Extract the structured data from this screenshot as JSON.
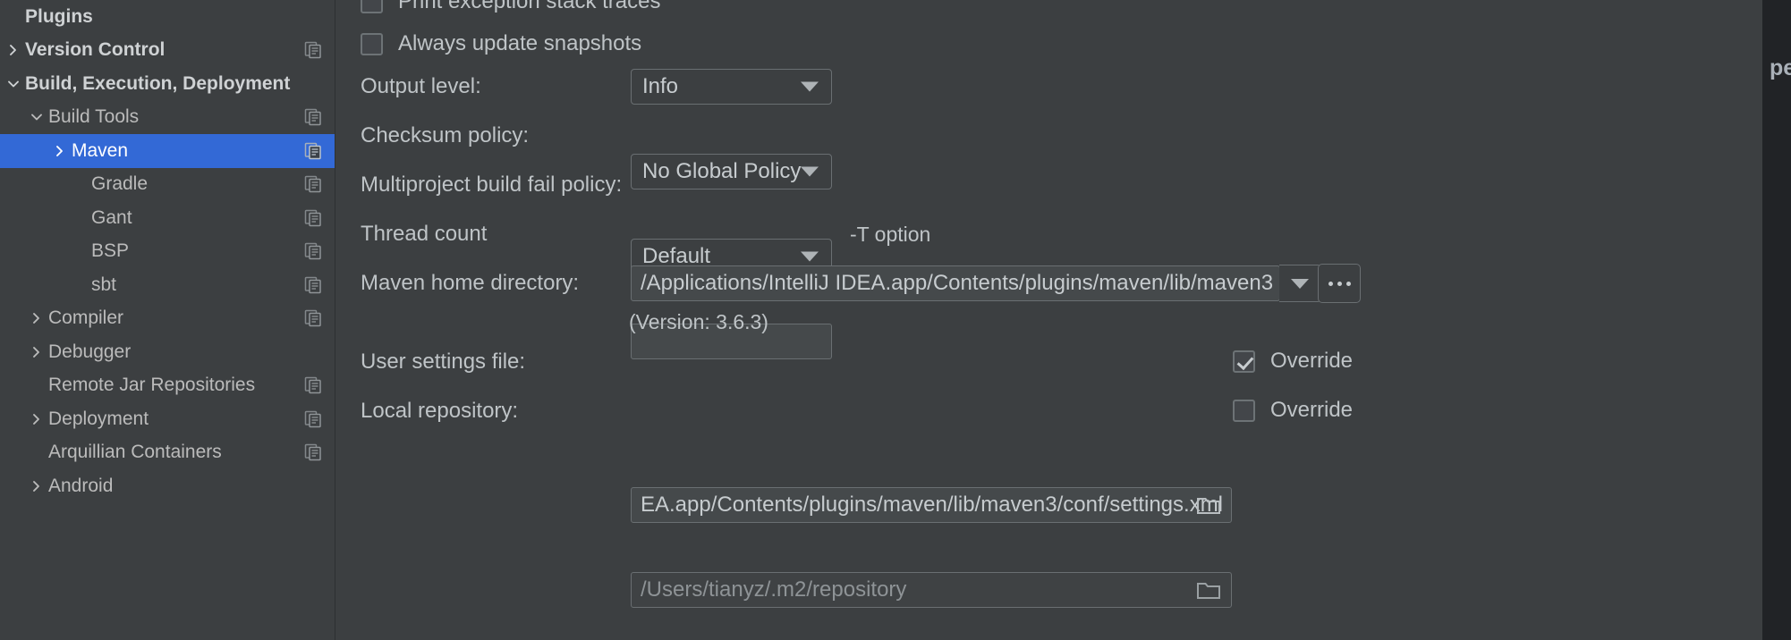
{
  "dialog": {
    "backdrop_text": "pe"
  },
  "sidebar": {
    "items": [
      {
        "label": "Plugins",
        "indent": 0,
        "twisty": "none",
        "bold": true,
        "selected": false,
        "copy": false
      },
      {
        "label": "Version Control",
        "indent": 0,
        "twisty": "collapsed",
        "bold": true,
        "selected": false,
        "copy": true
      },
      {
        "label": "Build, Execution, Deployment",
        "indent": 0,
        "twisty": "expanded",
        "bold": true,
        "selected": false,
        "copy": false
      },
      {
        "label": "Build Tools",
        "indent": 1,
        "twisty": "expanded",
        "bold": false,
        "selected": false,
        "copy": true
      },
      {
        "label": "Maven",
        "indent": 2,
        "twisty": "collapsed",
        "bold": false,
        "selected": true,
        "copy": true
      },
      {
        "label": "Gradle",
        "indent": 3,
        "twisty": "none",
        "bold": false,
        "selected": false,
        "copy": true
      },
      {
        "label": "Gant",
        "indent": 3,
        "twisty": "none",
        "bold": false,
        "selected": false,
        "copy": true
      },
      {
        "label": "BSP",
        "indent": 3,
        "twisty": "none",
        "bold": false,
        "selected": false,
        "copy": true
      },
      {
        "label": "sbt",
        "indent": 3,
        "twisty": "none",
        "bold": false,
        "selected": false,
        "copy": true
      },
      {
        "label": "Compiler",
        "indent": 1,
        "twisty": "collapsed",
        "bold": false,
        "selected": false,
        "copy": true
      },
      {
        "label": "Debugger",
        "indent": 1,
        "twisty": "collapsed",
        "bold": false,
        "selected": false,
        "copy": false
      },
      {
        "label": "Remote Jar Repositories",
        "indent": 1,
        "twisty": "none",
        "bold": false,
        "selected": false,
        "copy": true
      },
      {
        "label": "Deployment",
        "indent": 1,
        "twisty": "collapsed",
        "bold": false,
        "selected": false,
        "copy": true
      },
      {
        "label": "Arquillian Containers",
        "indent": 1,
        "twisty": "none",
        "bold": false,
        "selected": false,
        "copy": true
      },
      {
        "label": "Android",
        "indent": 1,
        "twisty": "collapsed",
        "bold": false,
        "selected": false,
        "copy": false
      }
    ]
  },
  "maven_settings": {
    "checkbox_print_stack_traces": {
      "label": "Print exception stack traces",
      "checked": false
    },
    "checkbox_always_update_snapshots": {
      "label": "Always update snapshots",
      "checked": false
    },
    "output_level": {
      "label": "Output level:",
      "value": "Info"
    },
    "checksum_policy": {
      "label": "Checksum policy:",
      "value": "No Global Policy"
    },
    "multiproject_build_fail_policy": {
      "label": "Multiproject build fail policy:",
      "value": "Default"
    },
    "thread_count": {
      "label": "Thread count",
      "value": "",
      "hint": "-T option"
    },
    "maven_home_directory": {
      "label": "Maven home directory:",
      "value": "/Applications/IntelliJ IDEA.app/Contents/plugins/maven/lib/maven3",
      "browse_button": "...",
      "version": "(Version: 3.6.3)"
    },
    "user_settings_file": {
      "label": "User settings file:",
      "value": "EA.app/Contents/plugins/maven/lib/maven3/conf/settings.xml",
      "override_label": "Override",
      "override_checked": true
    },
    "local_repository": {
      "label": "Local repository:",
      "value": "/Users/tianyz/.m2/repository",
      "override_label": "Override",
      "override_checked": false
    }
  },
  "colors": {
    "panel_bg": "#3C3F41",
    "selection_blue": "#3369D6",
    "text": "#BFC4C7",
    "backdrop": "#212326"
  }
}
